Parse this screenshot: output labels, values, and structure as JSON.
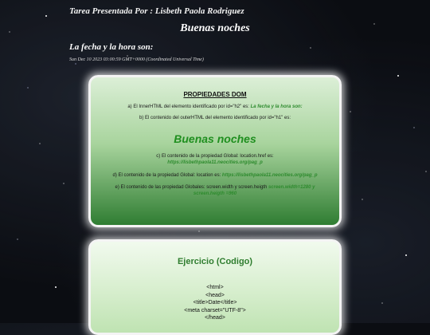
{
  "header": {
    "author": "Tarea Presentada Por : Lisbeth Paola Rodriguez",
    "greeting": "Buenas noches",
    "date_heading": "La fecha y la hora son:",
    "date_value": "Sun Dec 10 2023 03:00:59 GMT+0000 (Coordinated Universal Time)"
  },
  "props": {
    "title": "PROPIEDADES DOM",
    "a_text": "a) El InnerHTML del elemento identificado por id=\"h2\" es: ",
    "a_value": "La fecha y la hora son:",
    "b_text": "b) El contenido del outerHTML del elemento identificado por id=\"h1\" es:",
    "b_value": "Buenas noches",
    "c_text": "c) El contenido de la propiedad Global: location.href es:",
    "c_value": "https://lisbethpaola11.neocities.org/pag_p",
    "d_text": "d) El contenido de la propiedad Global: location es: ",
    "d_value": "https://lisbethpaola11.neocities.org/pag_p",
    "e_text": "e) El contenido de las propiedad Globales: screen.width y screen.heigth ",
    "e_value_1": "screen.width=1280 y",
    "e_value_2": "screen.heigth =960"
  },
  "exercise": {
    "title": "Ejercicio (Codigo)",
    "code_lines": [
      "<html>",
      "<head>",
      "<title>Date</title>",
      "<meta charset=\"UTF-8\">",
      "</head>"
    ]
  }
}
